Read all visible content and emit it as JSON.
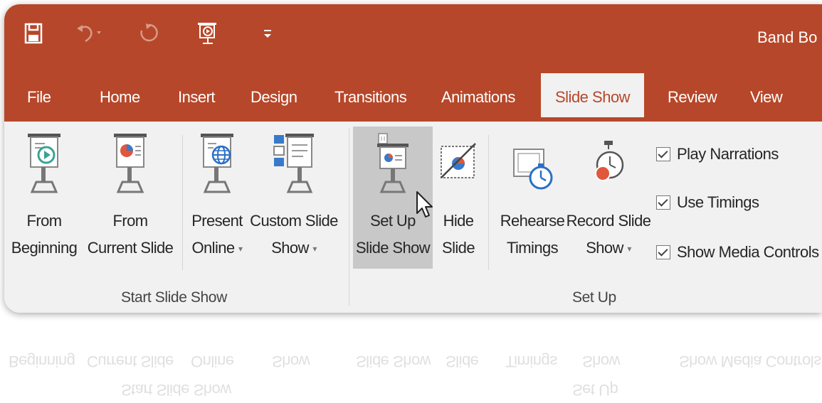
{
  "window": {
    "document_title": "Band Bo"
  },
  "quick_access": [
    {
      "name": "save-icon",
      "glyph": "🖫"
    },
    {
      "name": "undo-icon",
      "glyph": "↶"
    },
    {
      "name": "redo-icon",
      "glyph": "↻"
    },
    {
      "name": "start-from-beginning-icon",
      "glyph": ""
    },
    {
      "name": "customize-qat-icon",
      "glyph": "⩧"
    }
  ],
  "tabs": [
    "File",
    "Home",
    "Insert",
    "Design",
    "Transitions",
    "Animations",
    "Slide Show",
    "Review",
    "View"
  ],
  "active_tab": "Slide Show",
  "groups": {
    "start": {
      "label": "Start Slide Show",
      "buttons": [
        {
          "line1": "From",
          "line2": "Beginning"
        },
        {
          "line1": "From",
          "line2": "Current Slide"
        },
        {
          "line1": "Present",
          "line2": "Online",
          "dropdown": "▾"
        },
        {
          "line1": "Custom Slide",
          "line2": "Show",
          "dropdown": "▾"
        }
      ]
    },
    "setup": {
      "label": "Set Up",
      "buttons": [
        {
          "line1": "Set Up",
          "line2": "Slide Show"
        },
        {
          "line1": "Hide",
          "line2": "Slide"
        },
        {
          "line1": "Rehearse",
          "line2": "Timings"
        },
        {
          "line1": "Record Slide",
          "line2": "Show",
          "dropdown": "▾"
        }
      ],
      "checkboxes": [
        {
          "label": "Play Narrations",
          "checked": true
        },
        {
          "label": "Use Timings",
          "checked": true
        },
        {
          "label": "Show Media Controls",
          "checked": true
        }
      ]
    }
  },
  "colors": {
    "accent": "#b7472a",
    "ribbon_bg": "#f1f1f1",
    "pressed": "#c8c8c8"
  }
}
